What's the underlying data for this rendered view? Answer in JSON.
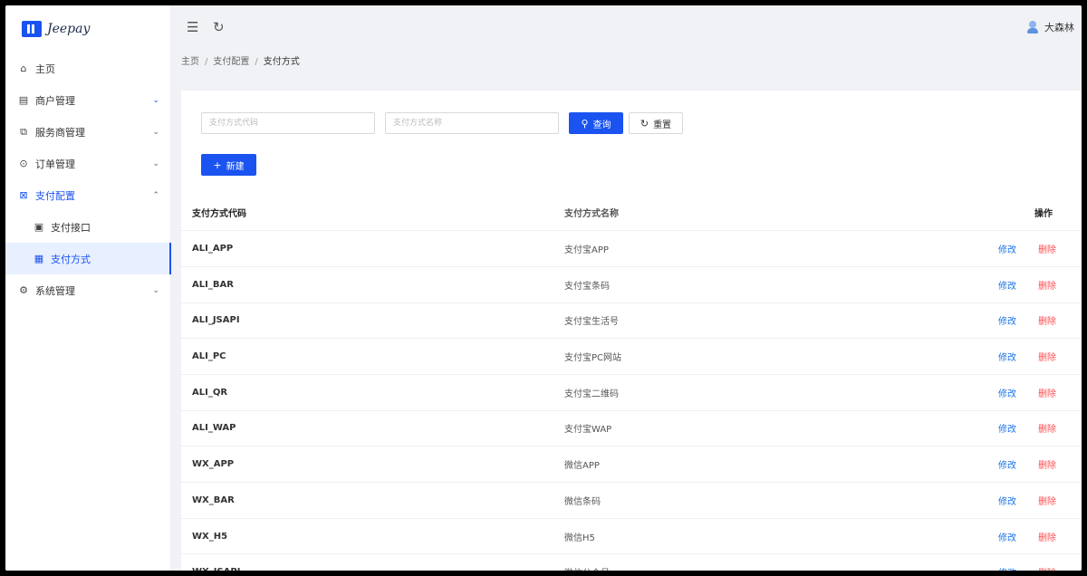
{
  "app": {
    "name": "Jeepay"
  },
  "sidebar": {
    "items": [
      {
        "label": "主页",
        "icon": "home-icon",
        "glyph": "⌂"
      },
      {
        "label": "商户管理",
        "icon": "merchant-icon",
        "glyph": "▤",
        "arrow": "⌄"
      },
      {
        "label": "服务商管理",
        "icon": "provider-icon",
        "glyph": "⧉",
        "arrow": "⌄"
      },
      {
        "label": "订单管理",
        "icon": "order-icon",
        "glyph": "⊙",
        "arrow": "⌄"
      },
      {
        "label": "支付配置",
        "icon": "payconfig-icon",
        "glyph": "⊠",
        "arrow": "⌃"
      },
      {
        "label": "系统管理",
        "icon": "settings-icon",
        "glyph": "⚙",
        "arrow": "⌄"
      }
    ],
    "submenu": [
      {
        "label": "支付接口",
        "icon": "interface-icon",
        "glyph": "▣"
      },
      {
        "label": "支付方式",
        "icon": "paymethod-icon",
        "glyph": "▦"
      }
    ]
  },
  "header": {
    "collapse_glyph": "☰",
    "refresh_glyph": "↻",
    "user": "大森林"
  },
  "breadcrumb": [
    "主页",
    "支付配置",
    "支付方式"
  ],
  "breadcrumb_sep": "/",
  "search": {
    "code_placeholder": "支付方式代码",
    "name_placeholder": "支付方式名称",
    "query_label": "查询",
    "query_glyph": "⚲",
    "reset_label": "重置",
    "reset_glyph": "↻"
  },
  "toolbar": {
    "new_label": "新建",
    "new_glyph": "+"
  },
  "table": {
    "headers": {
      "code": "支付方式代码",
      "name": "支付方式名称",
      "ops": "操作"
    },
    "edit_label": "修改",
    "delete_label": "删除",
    "rows": [
      {
        "code": "ALI_APP",
        "name": "支付宝APP"
      },
      {
        "code": "ALI_BAR",
        "name": "支付宝条码"
      },
      {
        "code": "ALI_JSAPI",
        "name": "支付宝生活号"
      },
      {
        "code": "ALI_PC",
        "name": "支付宝PC网站"
      },
      {
        "code": "ALI_QR",
        "name": "支付宝二维码"
      },
      {
        "code": "ALI_WAP",
        "name": "支付宝WAP"
      },
      {
        "code": "WX_APP",
        "name": "微信APP"
      },
      {
        "code": "WX_BAR",
        "name": "微信条码"
      },
      {
        "code": "WX_H5",
        "name": "微信H5"
      },
      {
        "code": "WX_JSAPI",
        "name": "微信公众号"
      }
    ]
  },
  "colors": {
    "primary": "#1a53f0",
    "danger": "#ff4d4f",
    "link": "#1a73e8"
  }
}
